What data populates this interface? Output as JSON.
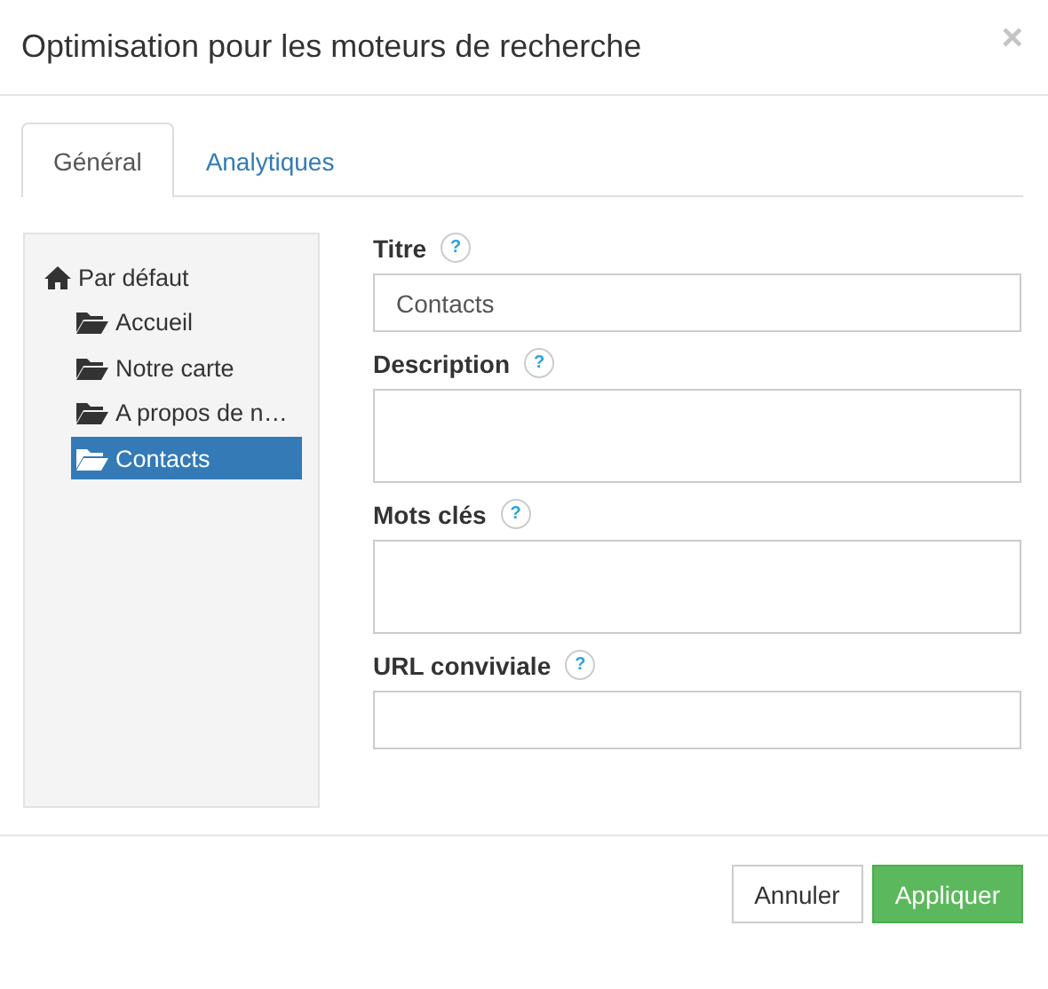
{
  "dialog": {
    "title": "Optimisation pour les moteurs de recherche",
    "close": "×"
  },
  "tabs": [
    {
      "label": "Général",
      "selected": true
    },
    {
      "label": "Analytiques",
      "selected": false
    }
  ],
  "tree": {
    "label": "Par défaut",
    "selected": false,
    "children": [
      {
        "label": "Accueil",
        "selected": false
      },
      {
        "label": "Notre carte",
        "selected": false
      },
      {
        "label": "A propos de n…",
        "selected": false
      },
      {
        "label": "Contacts",
        "selected": true
      }
    ]
  },
  "fields": [
    {
      "label": "Titre",
      "help": "?",
      "kind": "input",
      "value": "Contacts"
    },
    {
      "label": "Description",
      "help": "?",
      "kind": "textarea"
    },
    {
      "label": "Mots clés",
      "help": "?",
      "kind": "textarea"
    },
    {
      "label": "URL conviviale",
      "help": "?",
      "kind": "input"
    }
  ],
  "buttons": [
    {
      "label": "Annuler",
      "kind": "default"
    },
    {
      "label": "Appliquer",
      "kind": "primary"
    }
  ]
}
